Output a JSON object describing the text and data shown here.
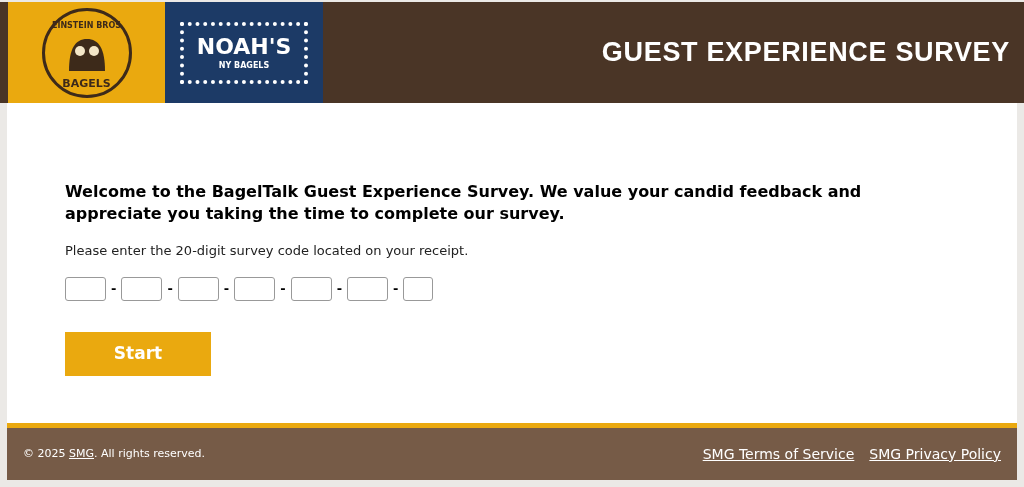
{
  "header": {
    "logos": [
      {
        "kind": "einstein",
        "top": "EINSTEIN BROS",
        "bottom": "BAGELS"
      },
      {
        "kind": "noahs",
        "top": "NOAH'S",
        "bottom": "NY BAGELS"
      }
    ],
    "title": "GUEST EXPERIENCE SURVEY"
  },
  "intro": "Welcome to the BagelTalk Guest Experience Survey. We value your candid feedback and appreciate you taking the time to complete our survey.",
  "instruction": "Please enter the 20-digit survey code located on your receipt.",
  "code_fields": [
    {
      "kind": "wide",
      "separator": "-"
    },
    {
      "kind": "wide",
      "separator": "-"
    },
    {
      "kind": "wide",
      "separator": "-"
    },
    {
      "kind": "wide",
      "separator": "-"
    },
    {
      "kind": "wide",
      "separator": "-"
    },
    {
      "kind": "wide",
      "separator": "-"
    },
    {
      "kind": "narrow"
    }
  ],
  "start_button": "Start",
  "footer": {
    "copyright_prefix": "© 2025 ",
    "copyright_link": "SMG",
    "copyright_suffix": ". All rights reserved.",
    "links": [
      "SMG Terms of Service",
      "SMG Privacy Policy"
    ]
  }
}
